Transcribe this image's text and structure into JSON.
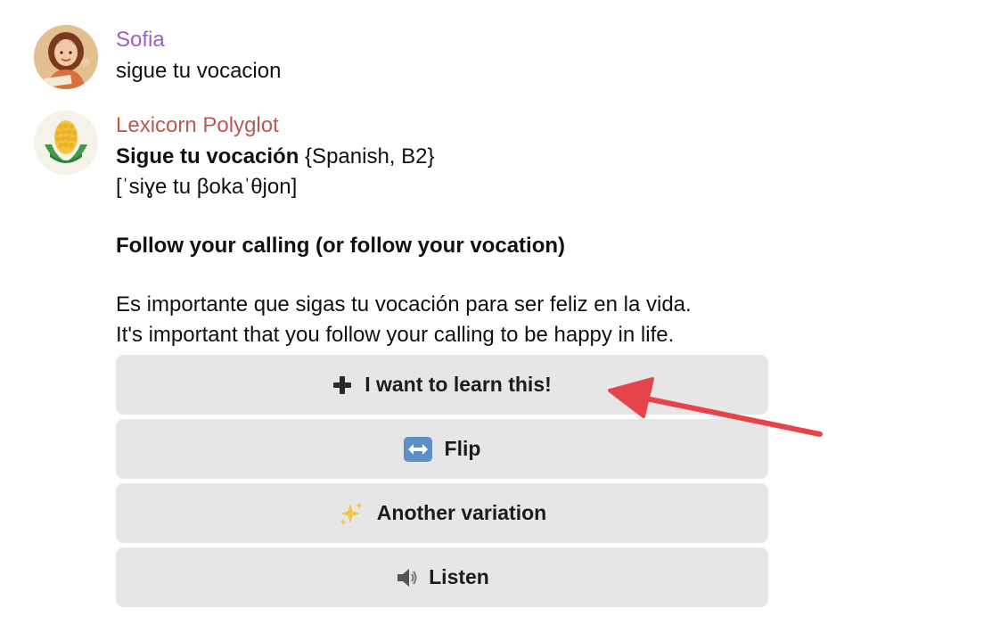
{
  "messages": [
    {
      "sender": "Sofia",
      "text": "sigue tu vocacion"
    },
    {
      "sender": "Lexicorn Polyglot",
      "phrase": "Sigue tu vocación",
      "phrase_meta": " {Spanish, B2}",
      "ipa": "[ˈsiɣe tu βokaˈθjon]",
      "translation": "Follow your calling (or follow your vocation)",
      "example_es": "Es importante que sigas tu vocación para ser feliz en la vida.",
      "example_en": "It's important that you follow your calling to be happy in life."
    }
  ],
  "buttons": [
    {
      "label": "I want to learn this!",
      "icon": "plus-icon"
    },
    {
      "label": "Flip",
      "icon": "left-right-arrow-icon"
    },
    {
      "label": "Another variation",
      "icon": "sparkles-icon"
    },
    {
      "label": "Listen",
      "icon": "speaker-icon"
    }
  ],
  "colors": {
    "sofia_name": "#9a5fc9",
    "bot_name": "#c0574b",
    "button_bg": "#e6e6e6",
    "annotation_arrow": "#e5454a"
  }
}
